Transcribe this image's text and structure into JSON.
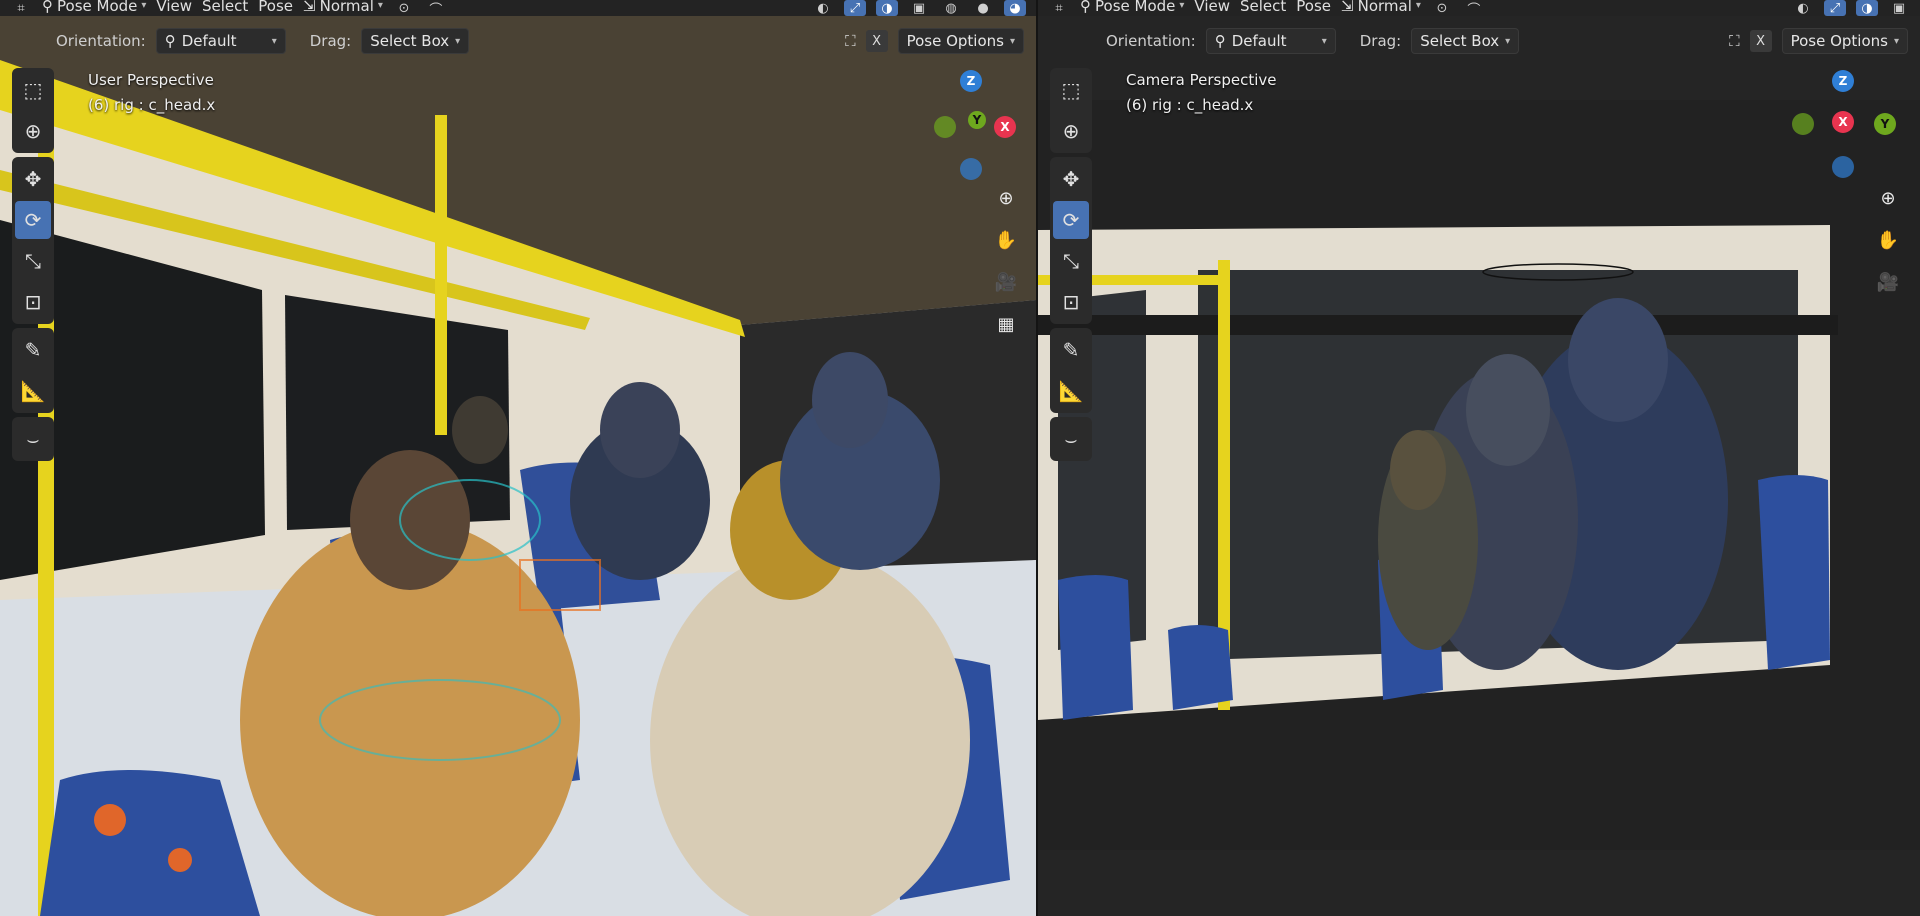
{
  "left": {
    "header": {
      "mode": "Pose Mode",
      "menus": [
        "View",
        "Select",
        "Pose"
      ],
      "transform_orientation": "Normal"
    },
    "subheader": {
      "orientation_label": "Orientation:",
      "orientation_value": "Default",
      "drag_label": "Drag:",
      "drag_value": "Select Box",
      "close": "X",
      "options": "Pose Options"
    },
    "info": {
      "view_name": "User Perspective",
      "active": "(6) rig : c_head.x"
    },
    "gizmo": {
      "z": "Z",
      "y": "Y",
      "x": "X"
    }
  },
  "right": {
    "header": {
      "mode": "Pose Mode",
      "menus": [
        "View",
        "Select",
        "Pose"
      ],
      "transform_orientation": "Normal"
    },
    "subheader": {
      "orientation_label": "Orientation:",
      "orientation_value": "Default",
      "drag_label": "Drag:",
      "drag_value": "Select Box",
      "close": "X",
      "options": "Pose Options"
    },
    "info": {
      "view_name": "Camera Perspective",
      "active": "(6) rig : c_head.x"
    },
    "gizmo": {
      "z": "Z",
      "y": "Y",
      "x": "X"
    }
  },
  "tools": [
    "select-box-icon",
    "cursor-icon",
    "move-icon",
    "rotate-icon",
    "scale-icon",
    "transform-icon",
    "annotate-icon",
    "measure-icon",
    "relax-icon"
  ],
  "colors": {
    "accent": "#4772b3",
    "axis_x": "#e8344f",
    "axis_y": "#6ea81e",
    "axis_z": "#2f7fd6",
    "pole_yellow": "#e6d31e",
    "seat_blue": "#2d4f9e",
    "seat_orange": "#e0662a",
    "wall": "#e3ddd0"
  }
}
